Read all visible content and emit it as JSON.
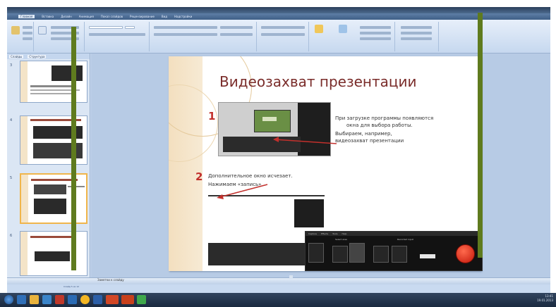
{
  "ribbon_tabs": [
    "Главная",
    "Вставка",
    "Дизайн",
    "Анимация",
    "Показ слайдов",
    "Рецензирование",
    "Вид",
    "Надстройки"
  ],
  "pane_tabs": [
    "Слайды",
    "Структура"
  ],
  "thumbnails": [
    {
      "number": "3"
    },
    {
      "number": "4"
    },
    {
      "number": "5"
    },
    {
      "number": "6"
    }
  ],
  "slide": {
    "title": "Видеозахват презентации",
    "marker1": "1",
    "marker2": "2",
    "text_right": [
      "При загрузке программы появляются",
      "окна для выбора работы.",
      "Выбираем, например,",
      "видеозахват  презентации"
    ],
    "text_middle": [
      "Дополнительное окно исчезает.",
      "Нажимаем «запись»"
    ]
  },
  "recorder": {
    "menu": [
      "Capture",
      "Effects",
      "Tools",
      "Help"
    ],
    "areas_label": "Select area",
    "input_label": "Recorded input"
  },
  "notes": {
    "placeholder": "Заметки к слайду"
  },
  "status": {
    "slide_info": "Слайд 5 из 12"
  },
  "tray": {
    "time": "13:41",
    "date": "19.01.2013"
  },
  "colors": {
    "vertical_bars": "#5f7b1e",
    "title": "#7a2c2a",
    "marker": "#c2302c"
  }
}
